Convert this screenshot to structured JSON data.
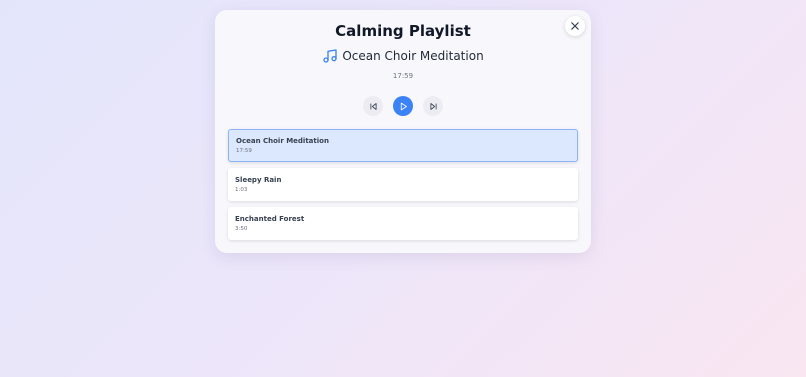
{
  "title": "Calming Playlist",
  "now_playing": {
    "icon": "music-note-icon",
    "track": "Ocean Choir Meditation",
    "time": "17:59"
  },
  "controls": {
    "previous_icon": "skip-previous-icon",
    "play_icon": "play-icon",
    "next_icon": "skip-next-icon"
  },
  "close_icon": "close-icon",
  "playlist": [
    {
      "title": "Ocean Choir Meditation",
      "duration": "17:59",
      "active": true
    },
    {
      "title": "Sleepy Rain",
      "duration": "1:03",
      "active": false
    },
    {
      "title": "Enchanted Forest",
      "duration": "3:50",
      "active": false
    }
  ],
  "colors": {
    "accent": "#3b82f6",
    "active_track_bg": "#dbe8fd",
    "active_track_border": "#8db4f4"
  }
}
